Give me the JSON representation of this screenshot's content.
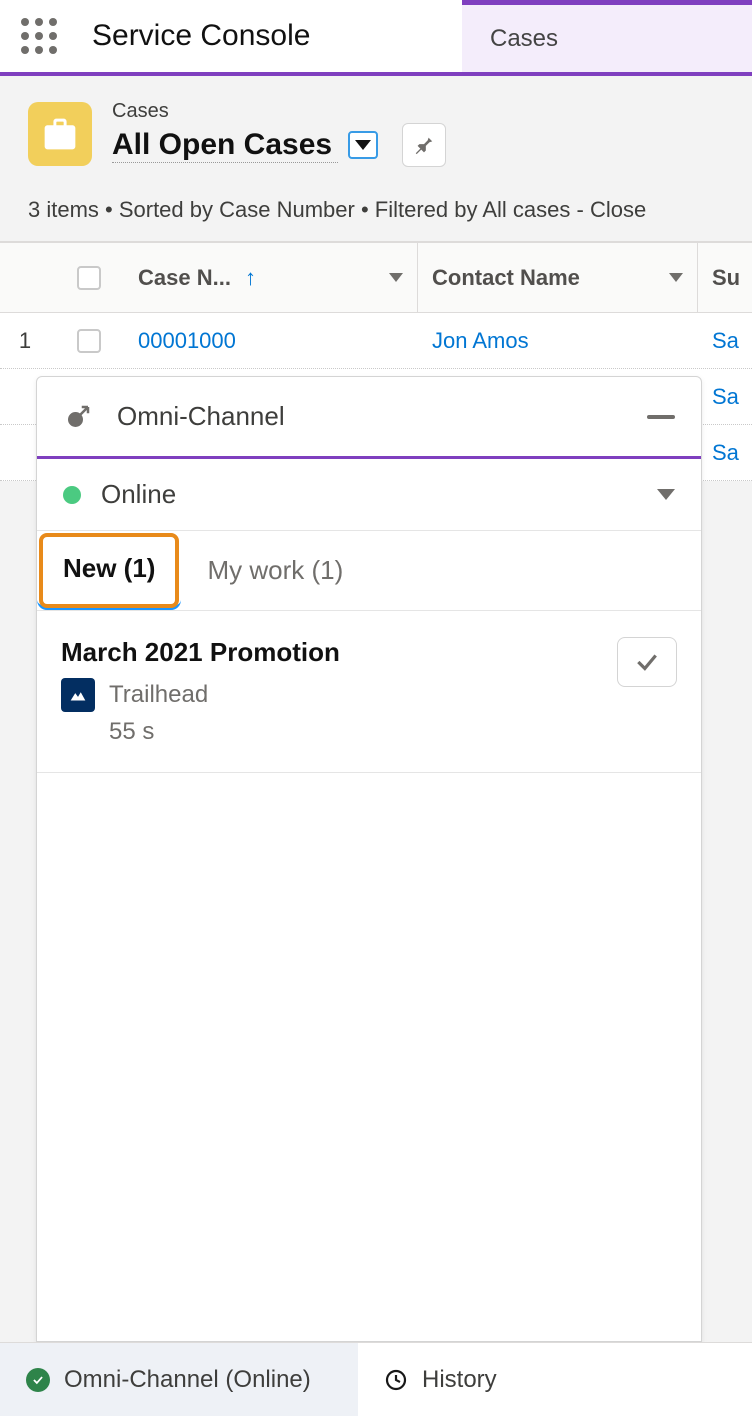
{
  "nav": {
    "app_title": "Service Console",
    "tab_label": "Cases"
  },
  "header": {
    "object_label": "Cases",
    "listview_name": "All Open Cases",
    "meta": "3 items • Sorted by Case Number • Filtered by All cases - Close"
  },
  "table": {
    "columns": {
      "case_number": "Case N...",
      "contact_name": "Contact Name",
      "subject": "Su"
    },
    "rows": [
      {
        "num": "1",
        "case_number": "00001000",
        "contact_name": "Jon Amos",
        "subject_peek": "Sa"
      },
      {
        "num": "",
        "case_number": "",
        "contact_name": "",
        "subject_peek": "Sa"
      },
      {
        "num": "",
        "case_number": "",
        "contact_name": "",
        "subject_peek": "Sa"
      }
    ]
  },
  "omni": {
    "title": "Omni-Channel",
    "status_label": "Online",
    "tabs": {
      "new": "New (1)",
      "my_work": "My work (1)"
    },
    "item": {
      "title": "March 2021 Promotion",
      "source": "Trailhead",
      "age": "55 s"
    }
  },
  "util": {
    "omni_label": "Omni-Channel (Online)",
    "history_label": "History"
  }
}
